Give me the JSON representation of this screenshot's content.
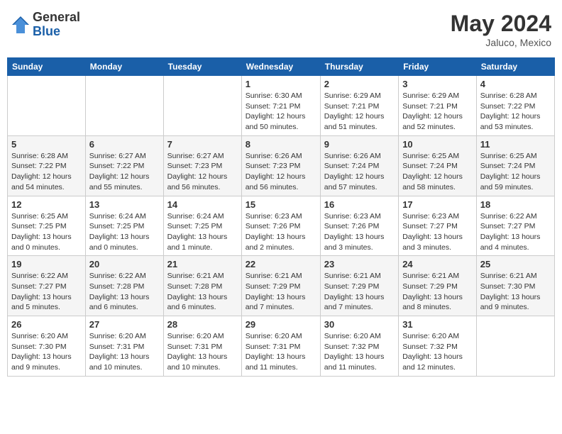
{
  "header": {
    "logo_general": "General",
    "logo_blue": "Blue",
    "month_title": "May 2024",
    "location": "Jaluco, Mexico"
  },
  "weekdays": [
    "Sunday",
    "Monday",
    "Tuesday",
    "Wednesday",
    "Thursday",
    "Friday",
    "Saturday"
  ],
  "weeks": [
    [
      {
        "day": "",
        "info": ""
      },
      {
        "day": "",
        "info": ""
      },
      {
        "day": "",
        "info": ""
      },
      {
        "day": "1",
        "info": "Sunrise: 6:30 AM\nSunset: 7:21 PM\nDaylight: 12 hours\nand 50 minutes."
      },
      {
        "day": "2",
        "info": "Sunrise: 6:29 AM\nSunset: 7:21 PM\nDaylight: 12 hours\nand 51 minutes."
      },
      {
        "day": "3",
        "info": "Sunrise: 6:29 AM\nSunset: 7:21 PM\nDaylight: 12 hours\nand 52 minutes."
      },
      {
        "day": "4",
        "info": "Sunrise: 6:28 AM\nSunset: 7:22 PM\nDaylight: 12 hours\nand 53 minutes."
      }
    ],
    [
      {
        "day": "5",
        "info": "Sunrise: 6:28 AM\nSunset: 7:22 PM\nDaylight: 12 hours\nand 54 minutes."
      },
      {
        "day": "6",
        "info": "Sunrise: 6:27 AM\nSunset: 7:22 PM\nDaylight: 12 hours\nand 55 minutes."
      },
      {
        "day": "7",
        "info": "Sunrise: 6:27 AM\nSunset: 7:23 PM\nDaylight: 12 hours\nand 56 minutes."
      },
      {
        "day": "8",
        "info": "Sunrise: 6:26 AM\nSunset: 7:23 PM\nDaylight: 12 hours\nand 56 minutes."
      },
      {
        "day": "9",
        "info": "Sunrise: 6:26 AM\nSunset: 7:24 PM\nDaylight: 12 hours\nand 57 minutes."
      },
      {
        "day": "10",
        "info": "Sunrise: 6:25 AM\nSunset: 7:24 PM\nDaylight: 12 hours\nand 58 minutes."
      },
      {
        "day": "11",
        "info": "Sunrise: 6:25 AM\nSunset: 7:24 PM\nDaylight: 12 hours\nand 59 minutes."
      }
    ],
    [
      {
        "day": "12",
        "info": "Sunrise: 6:25 AM\nSunset: 7:25 PM\nDaylight: 13 hours\nand 0 minutes."
      },
      {
        "day": "13",
        "info": "Sunrise: 6:24 AM\nSunset: 7:25 PM\nDaylight: 13 hours\nand 0 minutes."
      },
      {
        "day": "14",
        "info": "Sunrise: 6:24 AM\nSunset: 7:25 PM\nDaylight: 13 hours\nand 1 minute."
      },
      {
        "day": "15",
        "info": "Sunrise: 6:23 AM\nSunset: 7:26 PM\nDaylight: 13 hours\nand 2 minutes."
      },
      {
        "day": "16",
        "info": "Sunrise: 6:23 AM\nSunset: 7:26 PM\nDaylight: 13 hours\nand 3 minutes."
      },
      {
        "day": "17",
        "info": "Sunrise: 6:23 AM\nSunset: 7:27 PM\nDaylight: 13 hours\nand 3 minutes."
      },
      {
        "day": "18",
        "info": "Sunrise: 6:22 AM\nSunset: 7:27 PM\nDaylight: 13 hours\nand 4 minutes."
      }
    ],
    [
      {
        "day": "19",
        "info": "Sunrise: 6:22 AM\nSunset: 7:27 PM\nDaylight: 13 hours\nand 5 minutes."
      },
      {
        "day": "20",
        "info": "Sunrise: 6:22 AM\nSunset: 7:28 PM\nDaylight: 13 hours\nand 6 minutes."
      },
      {
        "day": "21",
        "info": "Sunrise: 6:21 AM\nSunset: 7:28 PM\nDaylight: 13 hours\nand 6 minutes."
      },
      {
        "day": "22",
        "info": "Sunrise: 6:21 AM\nSunset: 7:29 PM\nDaylight: 13 hours\nand 7 minutes."
      },
      {
        "day": "23",
        "info": "Sunrise: 6:21 AM\nSunset: 7:29 PM\nDaylight: 13 hours\nand 7 minutes."
      },
      {
        "day": "24",
        "info": "Sunrise: 6:21 AM\nSunset: 7:29 PM\nDaylight: 13 hours\nand 8 minutes."
      },
      {
        "day": "25",
        "info": "Sunrise: 6:21 AM\nSunset: 7:30 PM\nDaylight: 13 hours\nand 9 minutes."
      }
    ],
    [
      {
        "day": "26",
        "info": "Sunrise: 6:20 AM\nSunset: 7:30 PM\nDaylight: 13 hours\nand 9 minutes."
      },
      {
        "day": "27",
        "info": "Sunrise: 6:20 AM\nSunset: 7:31 PM\nDaylight: 13 hours\nand 10 minutes."
      },
      {
        "day": "28",
        "info": "Sunrise: 6:20 AM\nSunset: 7:31 PM\nDaylight: 13 hours\nand 10 minutes."
      },
      {
        "day": "29",
        "info": "Sunrise: 6:20 AM\nSunset: 7:31 PM\nDaylight: 13 hours\nand 11 minutes."
      },
      {
        "day": "30",
        "info": "Sunrise: 6:20 AM\nSunset: 7:32 PM\nDaylight: 13 hours\nand 11 minutes."
      },
      {
        "day": "31",
        "info": "Sunrise: 6:20 AM\nSunset: 7:32 PM\nDaylight: 13 hours\nand 12 minutes."
      },
      {
        "day": "",
        "info": ""
      }
    ]
  ]
}
